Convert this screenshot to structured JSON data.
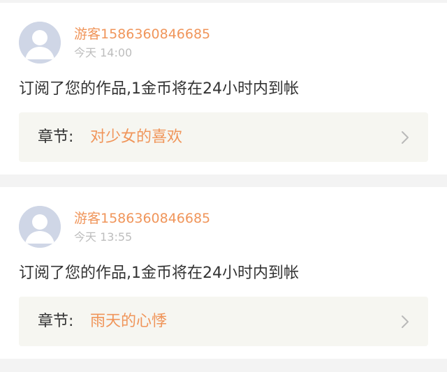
{
  "notifications": [
    {
      "username": "游客1586360846685",
      "timestamp": "今天 14:00",
      "message": "订阅了您的作品,1金币将在24小时内到帐",
      "chapter_label": "章节:",
      "chapter_title": "对少女的喜欢"
    },
    {
      "username": "游客1586360846685",
      "timestamp": "今天 13:55",
      "message": "订阅了您的作品,1金币将在24小时内到帐",
      "chapter_label": "章节:",
      "chapter_title": "雨天的心悸"
    }
  ],
  "colors": {
    "accent": "#f0955a",
    "text": "#333333",
    "muted": "#bdbdbd",
    "chapter_bg": "#f6f6f1",
    "page_bg": "#f3f3f3",
    "avatar_bg": "#cfd6e6"
  },
  "icons": {
    "avatar": "default-user-avatar-icon",
    "chevron": "chevron-right-icon"
  }
}
